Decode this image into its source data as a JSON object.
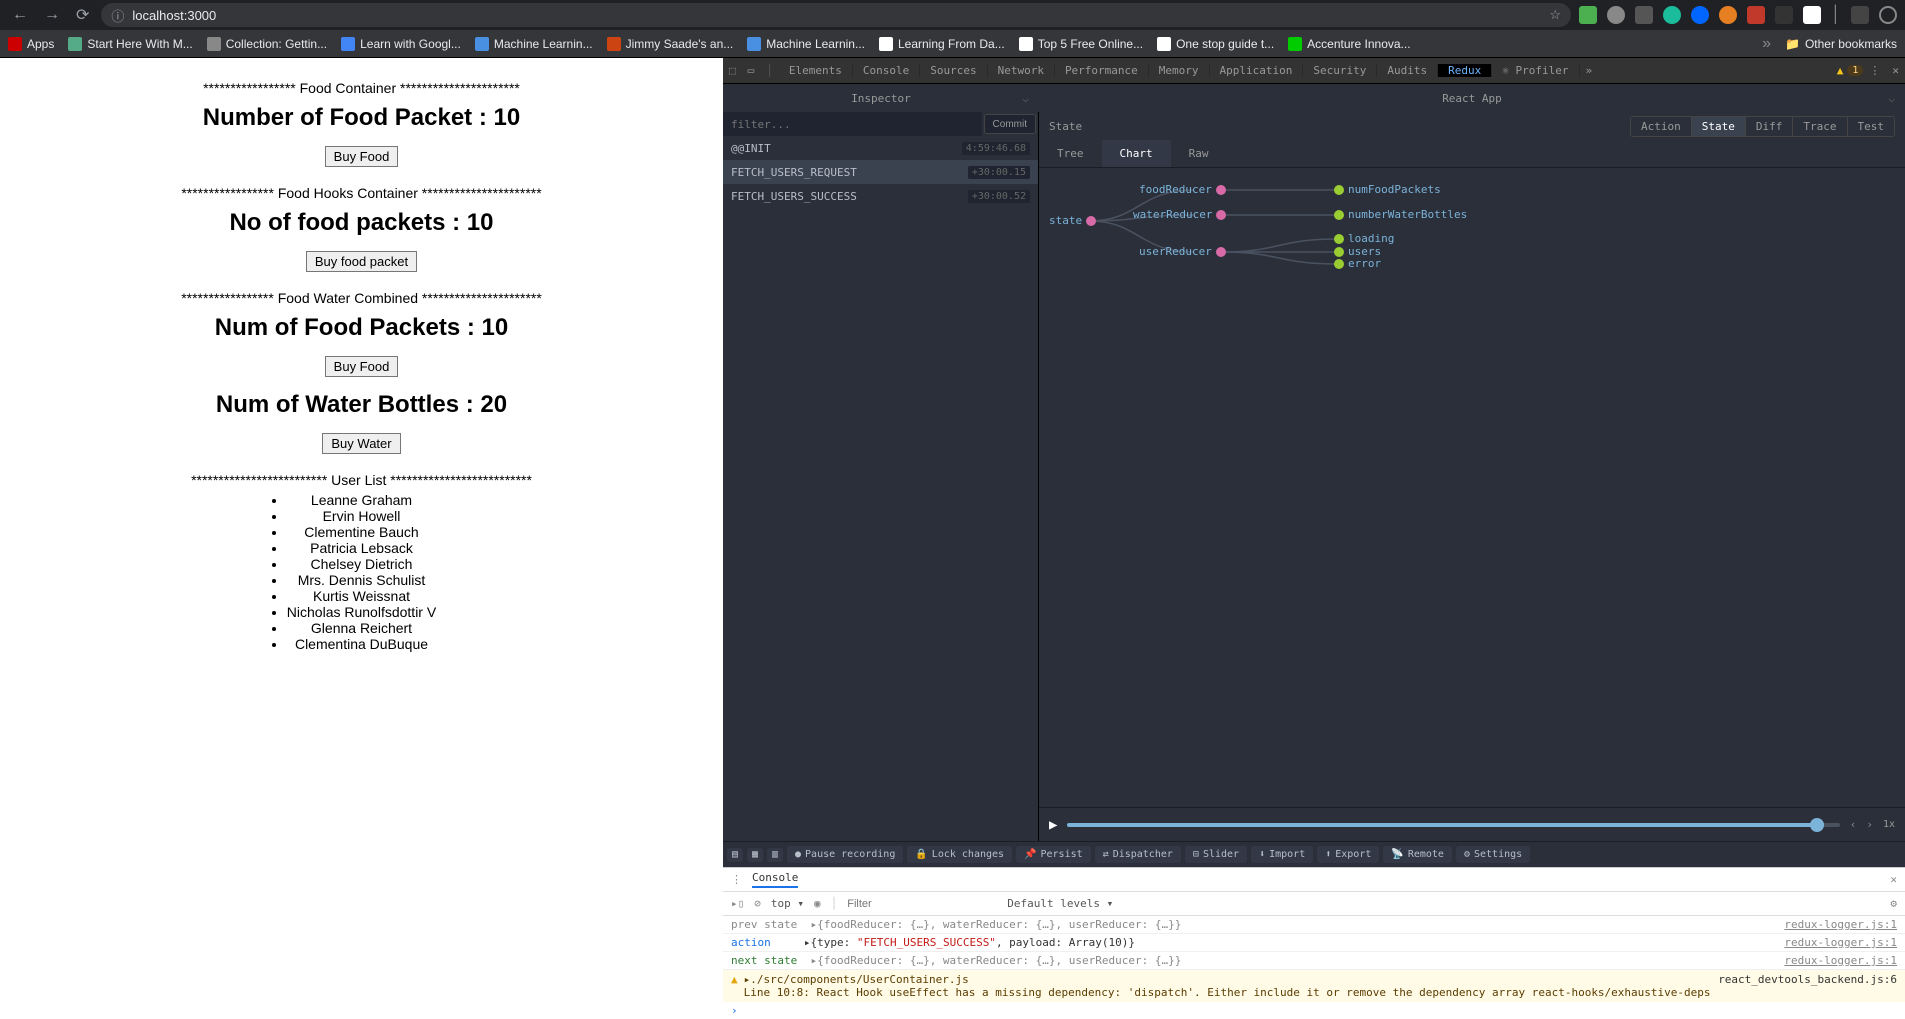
{
  "url": "localhost:3000",
  "bookmarks": [
    {
      "label": "Apps",
      "color": "#c00"
    },
    {
      "label": "Start Here With M...",
      "color": "#5a8"
    },
    {
      "label": "Collection: Gettin...",
      "color": "#888"
    },
    {
      "label": "Learn with Googl...",
      "color": "#4285f4"
    },
    {
      "label": "Machine Learnin...",
      "color": "#4a90e2"
    },
    {
      "label": "Jimmy Saade's an...",
      "color": "#c41"
    },
    {
      "label": "Machine Learnin...",
      "color": "#4a90e2"
    },
    {
      "label": "Learning From Da...",
      "color": "#fff"
    },
    {
      "label": "Top 5 Free Online...",
      "color": "#fff"
    },
    {
      "label": "One stop guide t...",
      "color": "#fff"
    },
    {
      "label": "Accenture Innova...",
      "color": "#0c0"
    }
  ],
  "other_bookmarks": "Other bookmarks",
  "page": {
    "sec1": "***************** Food Container **********************",
    "h1": "Number of Food Packet : 10",
    "btn1": "Buy Food",
    "sec2": "***************** Food Hooks Container **********************",
    "h2": "No of food packets : 10",
    "btn2": "Buy food packet",
    "sec3": "***************** Food Water Combined **********************",
    "h3": "Num of Food Packets : 10",
    "btn3": "Buy Food",
    "h4": "Num of Water Bottles : 20",
    "btn4": "Buy Water",
    "sec5": "************************* User List **************************",
    "users": [
      "Leanne Graham",
      "Ervin Howell",
      "Clementine Bauch",
      "Patricia Lebsack",
      "Chelsey Dietrich",
      "Mrs. Dennis Schulist",
      "Kurtis Weissnat",
      "Nicholas Runolfsdottir V",
      "Glenna Reichert",
      "Clementina DuBuque"
    ]
  },
  "devtools": {
    "tabs": [
      "Elements",
      "Console",
      "Sources",
      "Network",
      "Performance",
      "Memory",
      "Application",
      "Security",
      "Audits",
      "Redux",
      "Profiler"
    ],
    "active_tab": "Redux",
    "warn_count": "1"
  },
  "redux": {
    "inspector_label": "Inspector",
    "react_app": "React App",
    "filter_placeholder": "filter...",
    "commit": "Commit",
    "actions": [
      {
        "name": "@@INIT",
        "time": "4:59:46.68",
        "sel": false
      },
      {
        "name": "FETCH_USERS_REQUEST",
        "time": "+30:00.15",
        "sel": true
      },
      {
        "name": "FETCH_USERS_SUCCESS",
        "time": "+30:00.52",
        "sel": false
      }
    ],
    "state_label": "State",
    "segments": [
      "Action",
      "State",
      "Diff",
      "Trace",
      "Test"
    ],
    "active_segment": "State",
    "view_tabs": [
      "Tree",
      "Chart",
      "Raw"
    ],
    "active_view": "Chart",
    "nodes": {
      "state": "state",
      "foodReducer": "foodReducer",
      "waterReducer": "waterReducer",
      "userReducer": "userReducer",
      "numFoodPackets": "numFoodPackets",
      "numberWaterBottles": "numberWaterBottles",
      "loading": "loading",
      "users": "users",
      "error": "error"
    },
    "speed": "1x",
    "toolbar": [
      "Pause recording",
      "Lock changes",
      "Persist",
      "Dispatcher",
      "Slider",
      "Import",
      "Export",
      "Remote",
      "Settings"
    ]
  },
  "console": {
    "label": "Console",
    "scope": "top",
    "filter_ph": "Filter",
    "levels": "Default levels",
    "logs": {
      "prev": "prev state",
      "prev_obj": "▸{foodReducer: {…}, waterReducer: {…}, userReducer: {…}}",
      "action": "action",
      "action_obj_pre": "▸{type: ",
      "action_obj_type": "\"FETCH_USERS_SUCCESS\"",
      "action_obj_post": ", payload: Array(10)}",
      "next": "next state",
      "next_obj": "▸{foodReducer: {…}, waterReducer: {…}, userReducer: {…}}",
      "src": "redux-logger.js:1",
      "warn_file": "▸./src/components/UserContainer.js",
      "warn_msg": "Line 10:8:  React Hook useEffect has a missing dependency: 'dispatch'. Either include it or remove the dependency array  react-hooks/exhaustive-deps",
      "warn_src": "react_devtools_backend.js:6"
    }
  }
}
